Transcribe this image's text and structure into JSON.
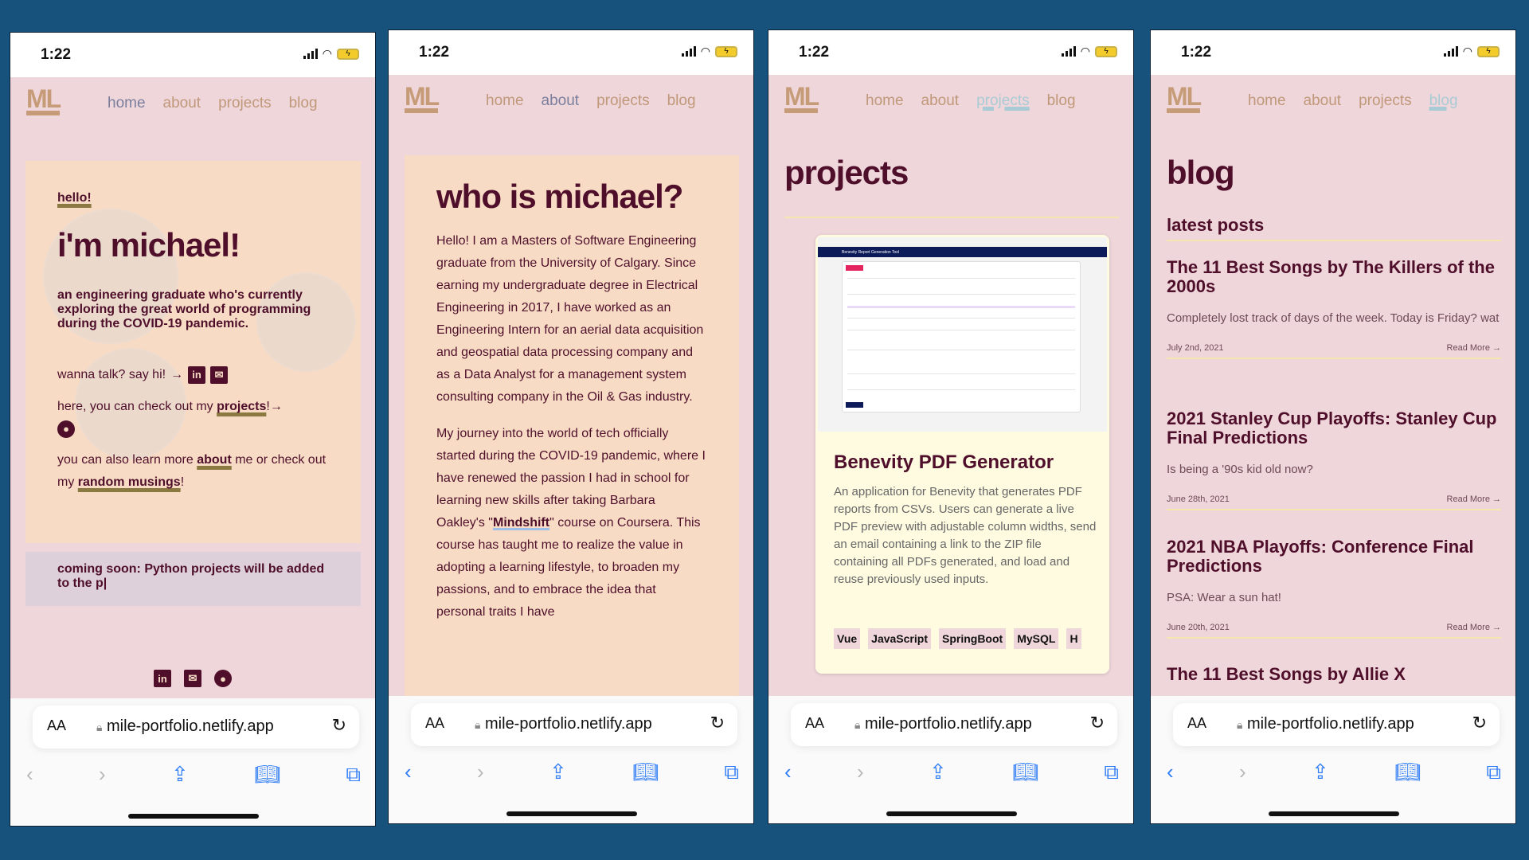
{
  "colors": {
    "background": "#17527c",
    "page": "#efd6da",
    "card": "#f7dbc4",
    "text": "#4f0f2b",
    "nav": "#c0987a",
    "accent_link": "#a9cbd6"
  },
  "status": {
    "time": "1:22"
  },
  "nav": {
    "logo": "ML",
    "items": [
      "home",
      "about",
      "projects",
      "blog"
    ]
  },
  "browser": {
    "aa": "AA",
    "url": "mile-portfolio.netlify.app"
  },
  "home": {
    "greeting": "hello!",
    "title": "i'm michael!",
    "subtitle": "an engineering graduate who's currently exploring the great world of programming during the COVID-19 pandemic.",
    "talk": "wanna talk? say hi!",
    "projects_pre": "here, you can check out my",
    "projects_link": "projects",
    "projects_post": "!",
    "learn_pre": "you can also learn more",
    "about_link": "about",
    "learn_mid": "me or check out my",
    "musings_link": "random musings",
    "learn_post": "!",
    "coming_soon": "coming soon: Python projects will be added to the p|"
  },
  "about": {
    "title": "who is michael?",
    "p1": "Hello! I am a Masters of Software Engineering graduate from the University of Calgary. Since earning my undergraduate degree in Electrical Engineering in 2017, I have worked as an Engineering Intern for an aerial data acquisition and geospatial data processing company and as a Data Analyst for a management system consulting company in the Oil & Gas industry.",
    "p2_pre": "My journey into the world of tech officially started during the COVID-19 pandemic, where I have renewed the passion I had in school for learning new skills after taking Barbara Oakley's \"",
    "p2_link": "Mindshift",
    "p2_post": "\" course on Coursera. This course has taught me to realize the value in adopting a learning lifestyle, to broaden my passions, and to embrace the idea that personal traits I have"
  },
  "projects": {
    "title": "projects",
    "items": [
      {
        "screenshot_title": "Benevity Report Generation Tool",
        "name": "Benevity PDF Generator",
        "description": "An application for Benevity that generates PDF reports from CSVs. Users can generate a live PDF preview with adjustable column widths, send an email containing a link to the ZIP file containing all PDFs generated, and load and reuse previously used inputs.",
        "tags": [
          "Vue",
          "JavaScript",
          "SpringBoot",
          "MySQL",
          "H"
        ]
      }
    ]
  },
  "blog": {
    "title": "blog",
    "subtitle": "latest posts",
    "read_more": "Read More →",
    "posts": [
      {
        "title": "The 11 Best Songs by The Killers of the 2000s",
        "excerpt": "Completely lost track of days of the week. Today is Friday? wat",
        "date": "July 2nd, 2021"
      },
      {
        "title": "2021 Stanley Cup Playoffs: Stanley Cup Final Predictions",
        "excerpt": "Is being a '90s kid old now?",
        "date": "June 28th, 2021"
      },
      {
        "title": "2021 NBA Playoffs: Conference Final Predictions",
        "excerpt": "PSA: Wear a sun hat!",
        "date": "June 20th, 2021"
      },
      {
        "title": "The 11 Best Songs by Allie X"
      }
    ]
  }
}
